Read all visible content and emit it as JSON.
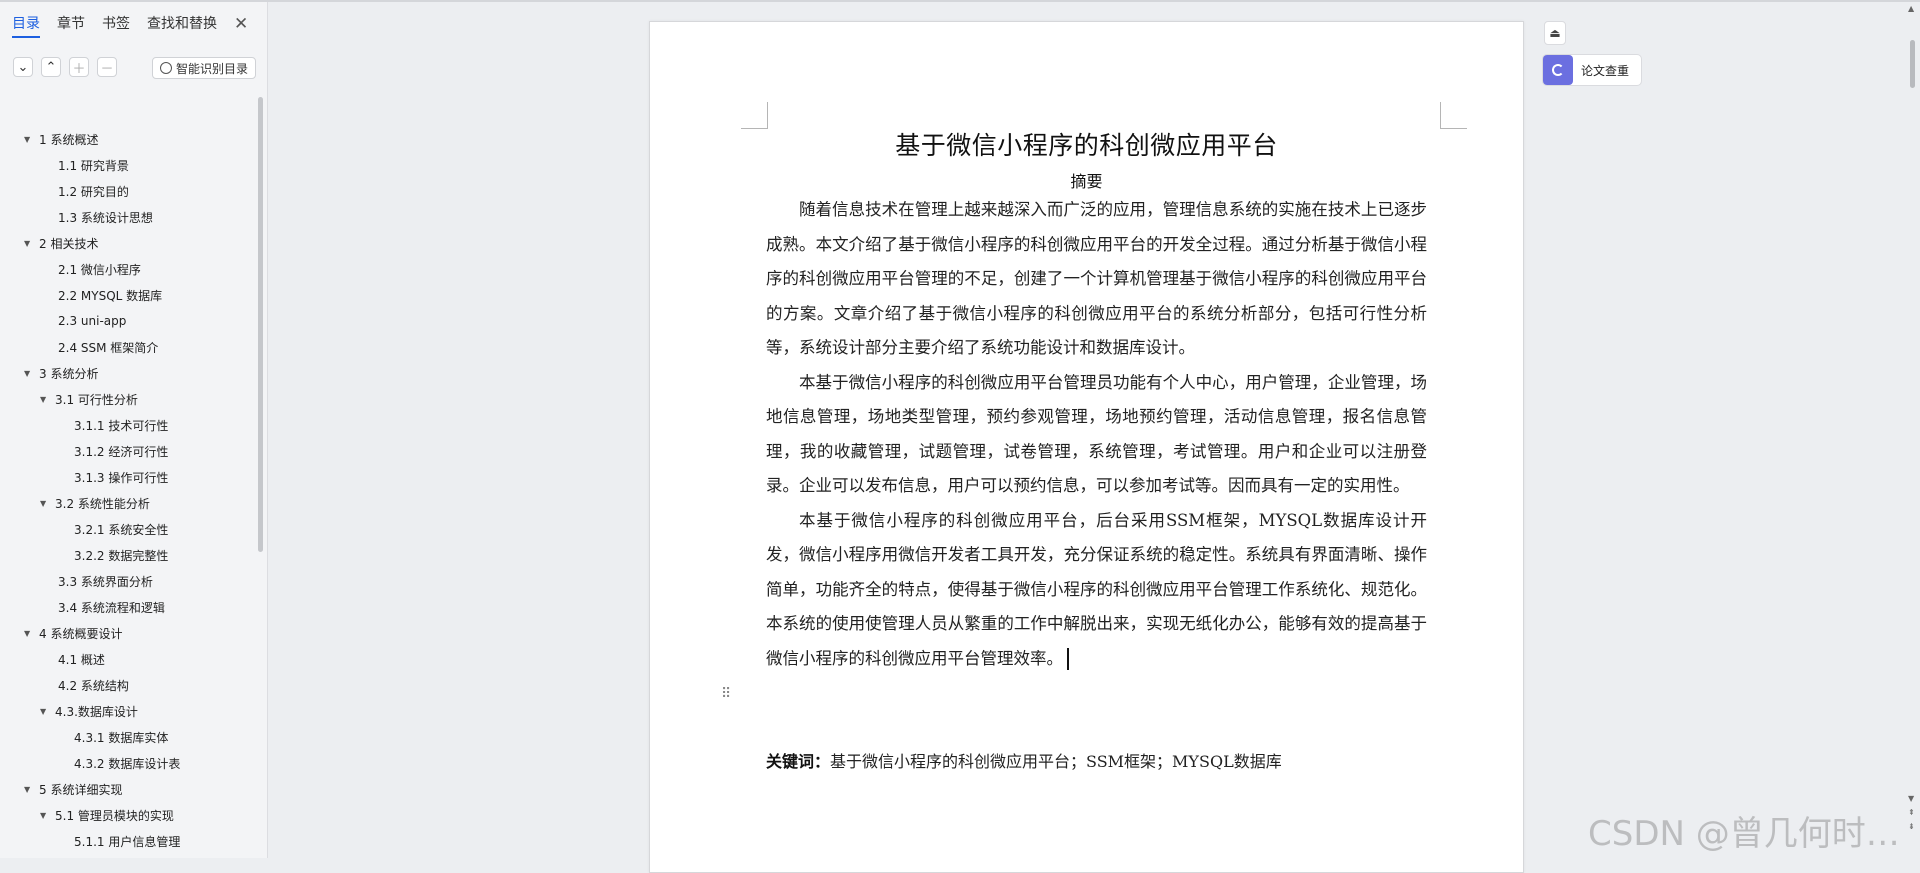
{
  "sidebar": {
    "tabs": [
      "目录",
      "章节",
      "书签",
      "查找和替换"
    ],
    "smart_button": "智能识别目录",
    "toc": [
      {
        "label": "1 系统概述",
        "level": 1,
        "expanded": true
      },
      {
        "label": "1.1  研究背景",
        "level": 2,
        "expanded": false
      },
      {
        "label": "1.2 研究目的",
        "level": 2,
        "expanded": false
      },
      {
        "label": "1.3 系统设计思想",
        "level": 2,
        "expanded": false
      },
      {
        "label": "2 相关技术",
        "level": 1,
        "expanded": true
      },
      {
        "label": "2.1 微信小程序",
        "level": 2,
        "expanded": false
      },
      {
        "label": "2.2 MYSQL 数据库",
        "level": 2,
        "expanded": false
      },
      {
        "label": "2.3 uni-app",
        "level": 2,
        "expanded": false
      },
      {
        "label": "2.4 SSM 框架简介",
        "level": 2,
        "expanded": false
      },
      {
        "label": "3 系统分析",
        "level": 1,
        "expanded": true
      },
      {
        "label": "3.1 可行性分析",
        "level": 2,
        "expanded": true
      },
      {
        "label": "3.1.1 技术可行性",
        "level": 3,
        "expanded": false
      },
      {
        "label": "3.1.2 经济可行性",
        "level": 3,
        "expanded": false
      },
      {
        "label": "3.1.3 操作可行性",
        "level": 3,
        "expanded": false
      },
      {
        "label": "3.2 系统性能分析",
        "level": 2,
        "expanded": true
      },
      {
        "label": "3.2.1  系统安全性",
        "level": 3,
        "expanded": false
      },
      {
        "label": "3.2.2  数据完整性",
        "level": 3,
        "expanded": false
      },
      {
        "label": "3.3 系统界面分析",
        "level": 2,
        "expanded": false
      },
      {
        "label": "3.4 系统流程和逻辑",
        "level": 2,
        "expanded": false
      },
      {
        "label": "4 系统概要设计",
        "level": 1,
        "expanded": true
      },
      {
        "label": "4.1 概述",
        "level": 2,
        "expanded": false
      },
      {
        "label": "4.2 系统结构",
        "level": 2,
        "expanded": false
      },
      {
        "label": "4.3.数据库设计",
        "level": 2,
        "expanded": true
      },
      {
        "label": "4.3.1 数据库实体",
        "level": 3,
        "expanded": false
      },
      {
        "label": "4.3.2 数据库设计表",
        "level": 3,
        "expanded": false
      },
      {
        "label": "5 系统详细实现",
        "level": 1,
        "expanded": true
      },
      {
        "label": "5.1  管理员模块的实现",
        "level": 2,
        "expanded": true
      },
      {
        "label": "5.1.1  用户信息管理",
        "level": 3,
        "expanded": false
      }
    ]
  },
  "document": {
    "title": "基于微信小程序的科创微应用平台",
    "abstract_heading": "摘要",
    "paragraphs": [
      "随着信息技术在管理上越来越深入而广泛的应用，管理信息系统的实施在技术上已逐步成熟。本文介绍了基于微信小程序的科创微应用平台的开发全过程。通过分析基于微信小程序的科创微应用平台管理的不足，创建了一个计算机管理基于微信小程序的科创微应用平台的方案。文章介绍了基于微信小程序的科创微应用平台的系统分析部分，包括可行性分析等，系统设计部分主要介绍了系统功能设计和数据库设计。",
      "本基于微信小程序的科创微应用平台管理员功能有个人中心，用户管理，企业管理，场地信息管理，场地类型管理，预约参观管理，场地预约管理，活动信息管理，报名信息管理，我的收藏管理，试题管理，试卷管理，系统管理，考试管理。用户和企业可以注册登录。企业可以发布信息，用户可以预约信息，可以参加考试等。因而具有一定的实用性。",
      "本基于微信小程序的科创微应用平台，后台采用SSM框架，MYSQL数据库设计开发，微信小程序用微信开发者工具开发，充分保证系统的稳定性。系统具有界面清晰、操作简单，功能齐全的特点，使得基于微信小程序的科创微应用平台管理工作系统化、规范化。本系统的使用使管理人员从繁重的工作中解脱出来，实现无纸化办公，能够有效的提高基于微信小程序的科创微应用平台管理效率。"
    ],
    "keywords_label": "关键词：",
    "keywords_value": "基于微信小程序的科创微应用平台；SSM框架；MYSQL数据库"
  },
  "right_panel": {
    "paper_check": "论文查重"
  },
  "watermark": "CSDN @曾几何时…"
}
